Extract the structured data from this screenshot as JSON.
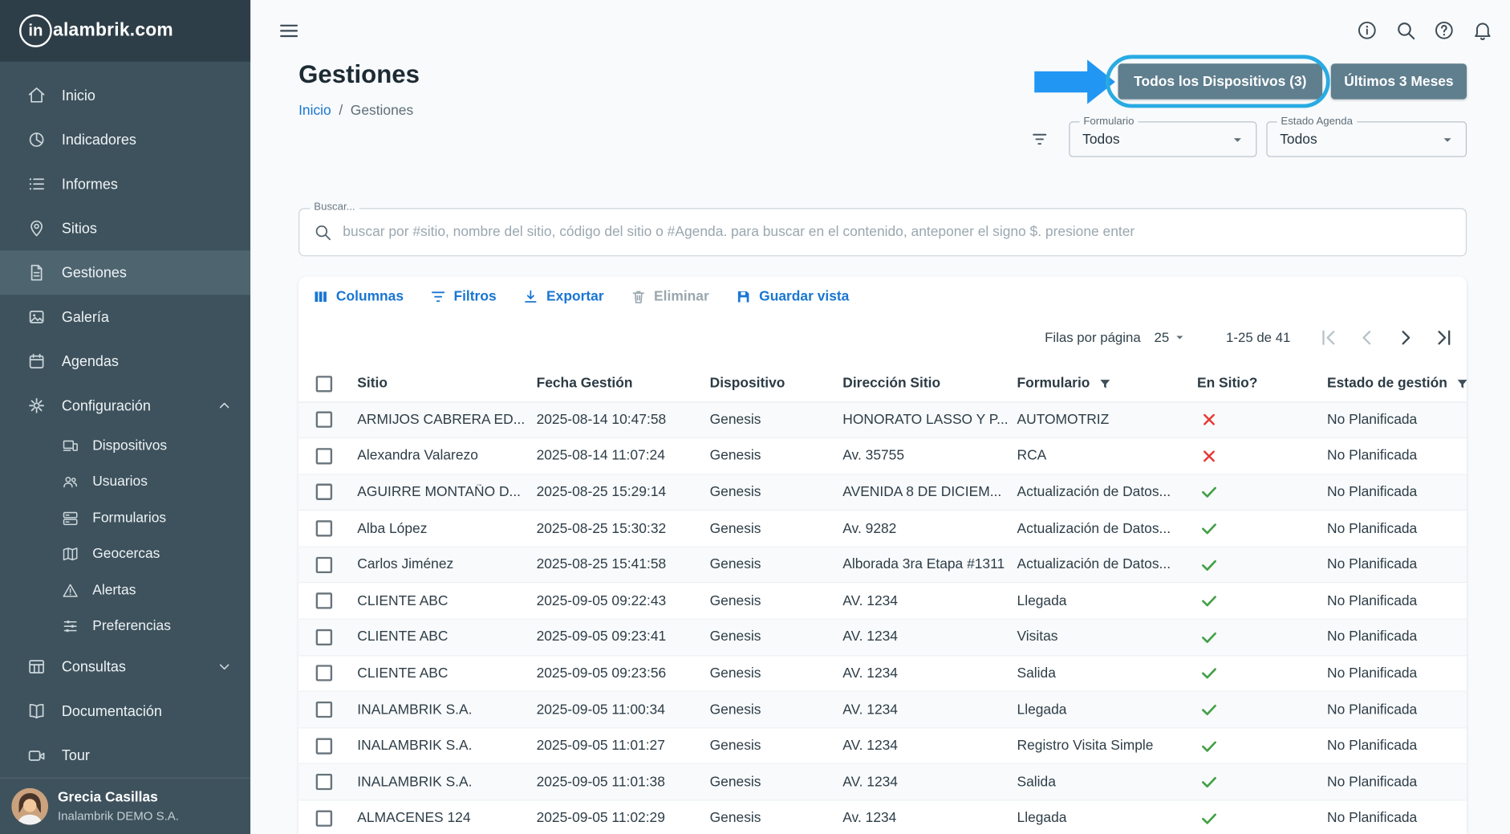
{
  "sidebar": {
    "logo": {
      "in": "in",
      "rest": "alambrik.com"
    },
    "items": [
      {
        "label": "Inicio"
      },
      {
        "label": "Indicadores"
      },
      {
        "label": "Informes"
      },
      {
        "label": "Sitios"
      },
      {
        "label": "Gestiones",
        "active": true
      },
      {
        "label": "Galería"
      },
      {
        "label": "Agendas"
      },
      {
        "label": "Configuración",
        "expanded": true
      },
      {
        "label": "Dispositivos",
        "sub": true
      },
      {
        "label": "Usuarios",
        "sub": true
      },
      {
        "label": "Formularios",
        "sub": true
      },
      {
        "label": "Geocercas",
        "sub": true
      },
      {
        "label": "Alertas",
        "sub": true
      },
      {
        "label": "Preferencias",
        "sub": true
      },
      {
        "label": "Consultas",
        "collapsed": true
      },
      {
        "label": "Documentación"
      },
      {
        "label": "Tour"
      }
    ],
    "user": {
      "name": "Grecia Casillas",
      "org": "Inalambrik DEMO S.A."
    }
  },
  "page": {
    "title": "Gestiones",
    "breadcrumb": {
      "home": "Inicio",
      "separator": "/",
      "current": "Gestiones"
    }
  },
  "actions": {
    "devices_button": "Todos los Dispositivos (3)",
    "period_button": "Últimos 3 Meses"
  },
  "filters": {
    "formulario": {
      "label": "Formulario",
      "value": "Todos"
    },
    "estado_agenda": {
      "label": "Estado Agenda",
      "value": "Todos"
    }
  },
  "search": {
    "label": "Buscar...",
    "placeholder": "buscar por #sitio, nombre del sitio, código del sitio o #Agenda. para buscar en el contenido, anteponer el signo $. presione enter"
  },
  "toolbar": {
    "columnas": "Columnas",
    "filtros": "Filtros",
    "exportar": "Exportar",
    "eliminar": "Eliminar",
    "guardar_vista": "Guardar vista"
  },
  "pagination": {
    "label": "Filas por página",
    "value": "25",
    "range": "1-25 de 41"
  },
  "table": {
    "columns": {
      "sitio": "Sitio",
      "fecha": "Fecha Gestión",
      "dispositivo": "Dispositivo",
      "direccion": "Dirección Sitio",
      "formulario": "Formulario",
      "en_sitio": "En Sitio?",
      "estado": "Estado de gestión"
    },
    "rows": [
      {
        "sitio": "ARMIJOS CABRERA ED...",
        "fecha": "2025-08-14 10:47:58",
        "dispositivo": "Genesis",
        "direccion": "HONORATO LASSO Y P...",
        "formulario": "AUTOMOTRIZ",
        "en_sitio": false,
        "estado": "No Planificada"
      },
      {
        "sitio": "Alexandra Valarezo",
        "fecha": "2025-08-14 11:07:24",
        "dispositivo": "Genesis",
        "direccion": "Av. 35755",
        "formulario": "RCA",
        "en_sitio": false,
        "estado": "No Planificada"
      },
      {
        "sitio": "AGUIRRE MONTAÑO D...",
        "fecha": "2025-08-25 15:29:14",
        "dispositivo": "Genesis",
        "direccion": "AVENIDA 8 DE DICIEM...",
        "formulario": "Actualización de Datos...",
        "en_sitio": true,
        "estado": "No Planificada"
      },
      {
        "sitio": "Alba López",
        "fecha": "2025-08-25 15:30:32",
        "dispositivo": "Genesis",
        "direccion": "Av. 9282",
        "formulario": "Actualización de Datos...",
        "en_sitio": true,
        "estado": "No Planificada"
      },
      {
        "sitio": "Carlos Jiménez",
        "fecha": "2025-08-25 15:41:58",
        "dispositivo": "Genesis",
        "direccion": "Alborada 3ra Etapa #1311",
        "formulario": "Actualización de Datos...",
        "en_sitio": true,
        "estado": "No Planificada"
      },
      {
        "sitio": "CLIENTE ABC",
        "fecha": "2025-09-05 09:22:43",
        "dispositivo": "Genesis",
        "direccion": "AV. 1234",
        "formulario": "Llegada",
        "en_sitio": true,
        "estado": "No Planificada"
      },
      {
        "sitio": "CLIENTE ABC",
        "fecha": "2025-09-05 09:23:41",
        "dispositivo": "Genesis",
        "direccion": "AV. 1234",
        "formulario": "Visitas",
        "en_sitio": true,
        "estado": "No Planificada"
      },
      {
        "sitio": "CLIENTE ABC",
        "fecha": "2025-09-05 09:23:56",
        "dispositivo": "Genesis",
        "direccion": "AV. 1234",
        "formulario": "Salida",
        "en_sitio": true,
        "estado": "No Planificada"
      },
      {
        "sitio": "INALAMBRIK S.A.",
        "fecha": "2025-09-05 11:00:34",
        "dispositivo": "Genesis",
        "direccion": "AV. 1234",
        "formulario": "Llegada",
        "en_sitio": true,
        "estado": "No Planificada"
      },
      {
        "sitio": "INALAMBRIK S.A.",
        "fecha": "2025-09-05 11:01:27",
        "dispositivo": "Genesis",
        "direccion": "AV. 1234",
        "formulario": "Registro Visita Simple",
        "en_sitio": true,
        "estado": "No Planificada"
      },
      {
        "sitio": "INALAMBRIK S.A.",
        "fecha": "2025-09-05 11:01:38",
        "dispositivo": "Genesis",
        "direccion": "AV. 1234",
        "formulario": "Salida",
        "en_sitio": true,
        "estado": "No Planificada"
      },
      {
        "sitio": "ALMACENES 124",
        "fecha": "2025-09-05 11:02:29",
        "dispositivo": "Genesis",
        "direccion": "Av. 1234",
        "formulario": "Llegada",
        "en_sitio": true,
        "estado": "No Planificada"
      }
    ]
  },
  "icons": {
    "en_sitio_yes": "✓",
    "en_sitio_no": "✕"
  },
  "colors": {
    "accent_link": "#1976d2",
    "button_bg": "#5f7e8e",
    "annotation_blue": "#2196f3",
    "ring_blue": "#29abe2",
    "check_green": "#43a047",
    "cross_red": "#e53935",
    "sidebar_bg": "#3e525d",
    "sidebar_logo_bg": "#2e3e48",
    "sidebar_active_bg": "#4e6570",
    "page_bg": "#f8fafc"
  }
}
